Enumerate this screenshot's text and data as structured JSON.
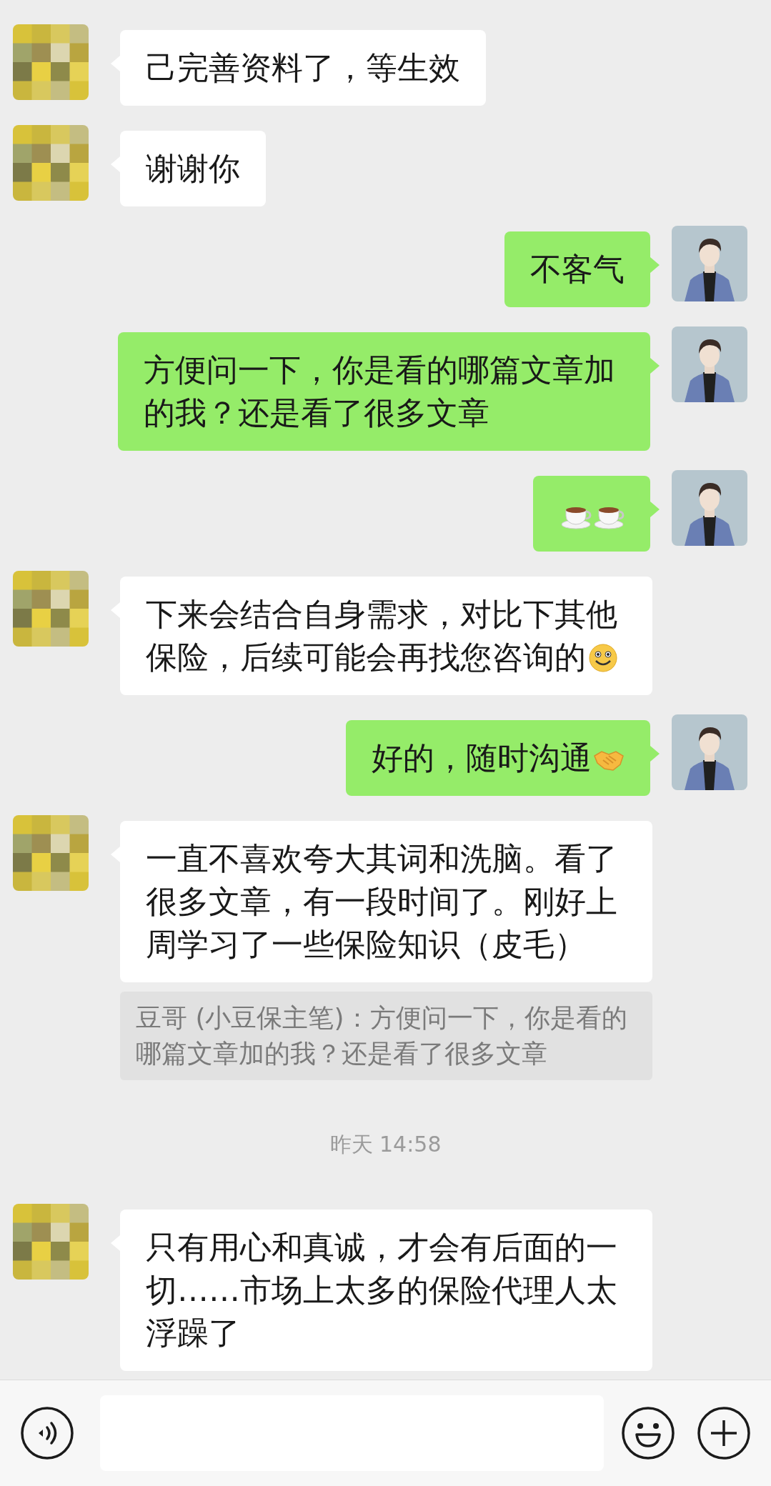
{
  "messages": [
    {
      "kind": "incoming",
      "text": "己完善资料了，等生效"
    },
    {
      "kind": "incoming",
      "text": "谢谢你"
    },
    {
      "kind": "outgoing",
      "text": "不客气"
    },
    {
      "kind": "outgoing",
      "text": "方便问一下，你是看的哪篇文章加的我？还是看了很多文章"
    },
    {
      "kind": "outgoing",
      "icons": [
        {
          "kind": "coffee"
        },
        {
          "kind": "coffee"
        }
      ]
    },
    {
      "kind": "incoming",
      "text": "下来会结合自身需求，对比下其他保险，后续可能会再找您咨询的",
      "icons": [
        {
          "kind": "smile"
        }
      ]
    },
    {
      "kind": "outgoing",
      "text": "好的，随时沟通",
      "icons": [
        {
          "kind": "handshake"
        }
      ]
    },
    {
      "kind": "incoming",
      "text": "一直不喜欢夸大其词和洗脑。看了很多文章，有一段时间了。刚好上周学习了一些保险知识（皮毛）",
      "quote": "豆哥 (小豆保主笔)：方便问一下，你是看的哪篇文章加的我？还是看了很多文章"
    },
    {
      "kind": "time",
      "text": "昨天 14:58"
    },
    {
      "kind": "incoming",
      "text": "只有用心和真诚，才会有后面的一切……市场上太多的保险代理人太浮躁了"
    }
  ]
}
